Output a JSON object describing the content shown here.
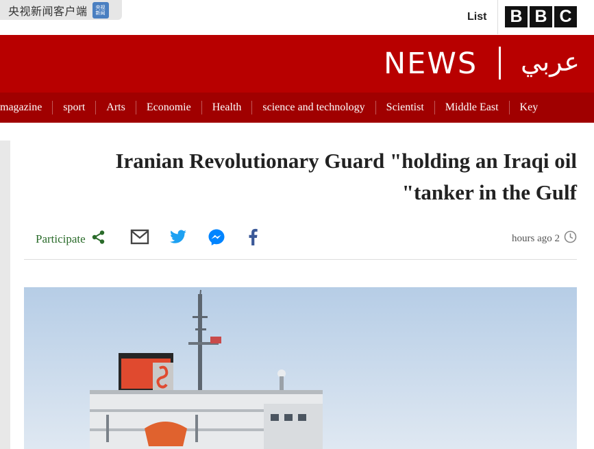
{
  "top_strip": {
    "app_badge_text": "央视新闻客户端",
    "app_logo_text": "央视新闻",
    "list_label": "List",
    "bbc_letters": [
      "B",
      "B",
      "C"
    ]
  },
  "banner": {
    "news_label": "NEWS",
    "arabic_label": "عربي",
    "background": "#b80000"
  },
  "nav": {
    "items": [
      "magazine",
      "sport",
      "Arts",
      "Economie",
      "Health",
      "science and technology",
      "Scientist",
      "Middle East",
      "Key"
    ]
  },
  "article": {
    "headline_line1": "Iranian Revolutionary Guard \"holding an Iraqi oil",
    "headline_line2": "\"tanker in the Gulf",
    "participate_label": "Participate",
    "timestamp": "hours ago 2",
    "accent": "#2a6b2a"
  },
  "share_icons": [
    "share-icon",
    "email-icon",
    "twitter-icon",
    "messenger-icon",
    "facebook-icon",
    "clock-icon"
  ]
}
